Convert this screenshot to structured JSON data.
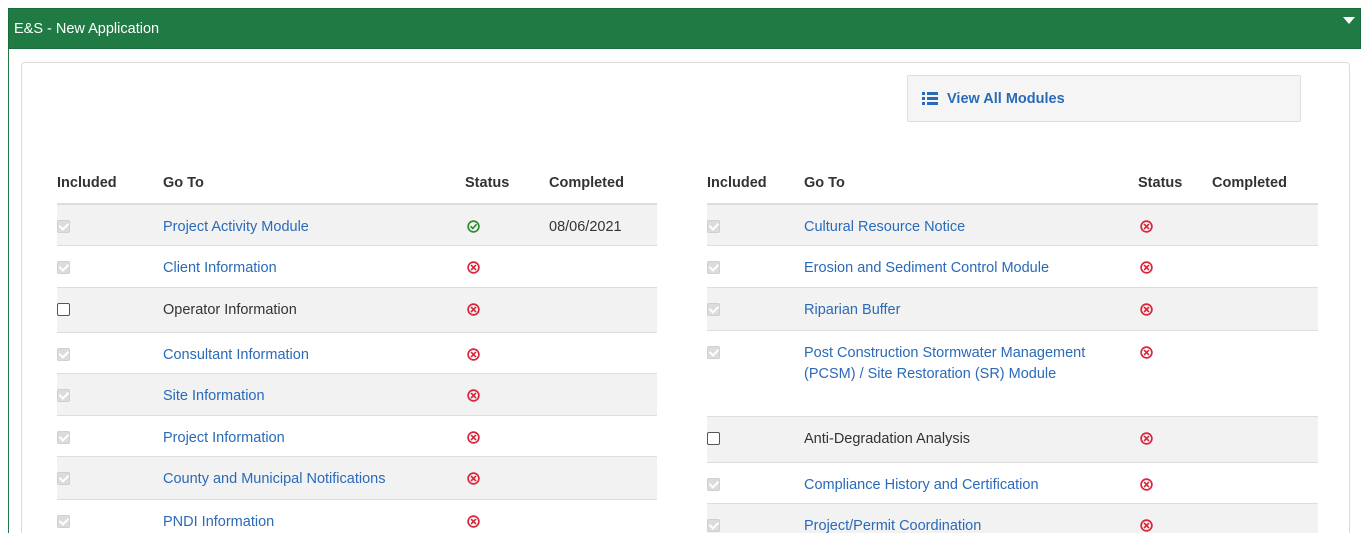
{
  "panel": {
    "title": "E&S - New Application"
  },
  "view_all": {
    "label": "View All Modules",
    "icon": "list-icon"
  },
  "columns": {
    "included": "Included",
    "goto": "Go To",
    "status": "Status",
    "completed": "Completed"
  },
  "colors": {
    "header_green": "#1f7a44",
    "link_blue": "#2a6ab8",
    "status_error": "#d9263a",
    "status_complete": "#2e8b2e"
  },
  "left_rows": [
    {
      "name": "Project Activity Module",
      "included": true,
      "included_enabled": false,
      "is_link": true,
      "status": "complete",
      "status_icon": "check-circle-icon",
      "completed": "08/06/2021"
    },
    {
      "name": "Client Information",
      "included": true,
      "included_enabled": false,
      "is_link": true,
      "status": "incomplete",
      "status_icon": "x-circle-icon",
      "completed": ""
    },
    {
      "name": "Operator Information",
      "included": false,
      "included_enabled": true,
      "is_link": false,
      "status": "incomplete",
      "status_icon": "x-circle-icon",
      "completed": ""
    },
    {
      "name": "Consultant Information",
      "included": true,
      "included_enabled": false,
      "is_link": true,
      "status": "incomplete",
      "status_icon": "x-circle-icon",
      "completed": ""
    },
    {
      "name": "Site Information",
      "included": true,
      "included_enabled": false,
      "is_link": true,
      "status": "incomplete",
      "status_icon": "x-circle-icon",
      "completed": ""
    },
    {
      "name": "Project Information",
      "included": true,
      "included_enabled": false,
      "is_link": true,
      "status": "incomplete",
      "status_icon": "x-circle-icon",
      "completed": ""
    },
    {
      "name": "County and Municipal Notifications",
      "included": true,
      "included_enabled": false,
      "is_link": true,
      "status": "incomplete",
      "status_icon": "x-circle-icon",
      "completed": ""
    },
    {
      "name": "PNDI Information",
      "included": true,
      "included_enabled": false,
      "is_link": true,
      "status": "incomplete",
      "status_icon": "x-circle-icon",
      "completed": ""
    }
  ],
  "right_rows": [
    {
      "name": "Cultural Resource Notice",
      "included": true,
      "included_enabled": false,
      "is_link": true,
      "status": "incomplete",
      "status_icon": "x-circle-icon",
      "completed": ""
    },
    {
      "name": "Erosion and Sediment Control Module",
      "included": true,
      "included_enabled": false,
      "is_link": true,
      "status": "incomplete",
      "status_icon": "x-circle-icon",
      "completed": ""
    },
    {
      "name": "Riparian Buffer",
      "included": true,
      "included_enabled": false,
      "is_link": true,
      "status": "incomplete",
      "status_icon": "x-circle-icon",
      "completed": ""
    },
    {
      "name": "Post Construction Stormwater Management (PCSM) / Site Restoration (SR) Module",
      "included": true,
      "included_enabled": false,
      "is_link": true,
      "status": "incomplete",
      "status_icon": "x-circle-icon",
      "completed": ""
    },
    {
      "name": "Anti-Degradation Analysis",
      "included": false,
      "included_enabled": true,
      "is_link": false,
      "status": "incomplete",
      "status_icon": "x-circle-icon",
      "completed": ""
    },
    {
      "name": "Compliance History and Certification",
      "included": true,
      "included_enabled": false,
      "is_link": true,
      "status": "incomplete",
      "status_icon": "x-circle-icon",
      "completed": ""
    },
    {
      "name": "Project/Permit Coordination",
      "included": true,
      "included_enabled": false,
      "is_link": true,
      "status": "incomplete",
      "status_icon": "x-circle-icon",
      "completed": ""
    }
  ]
}
